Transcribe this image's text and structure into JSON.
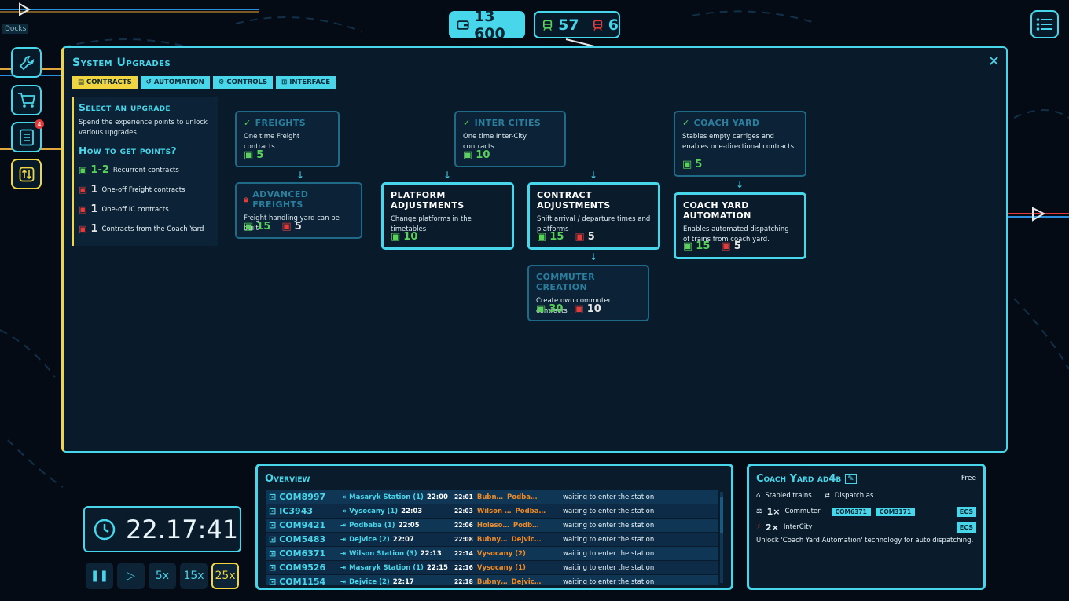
{
  "hud": {
    "money": "13 600",
    "green_points": "57",
    "red_points": "6"
  },
  "map": {
    "label": "Docks"
  },
  "sidebar": {
    "notebook_badge": "4"
  },
  "panel": {
    "title": "System Upgrades",
    "tabs": [
      {
        "label": "Contracts",
        "active": true
      },
      {
        "label": "Automation",
        "active": false
      },
      {
        "label": "Controls",
        "active": false
      },
      {
        "label": "Interface",
        "active": false
      }
    ],
    "info": {
      "heading": "Select an upgrade",
      "text": "Spend the experience points to unlock various upgrades.",
      "how_heading": "How to get points?",
      "rows": [
        {
          "num": "1-2",
          "text": "Recurrent contracts"
        },
        {
          "num": "1",
          "text": "One-off Freight contracts"
        },
        {
          "num": "1",
          "text": "One-off IC contracts"
        },
        {
          "num": "1",
          "text": "Contracts from the Coach Yard"
        }
      ]
    },
    "cards": {
      "freights": {
        "title": "Freights",
        "desc": "One time Freight contracts",
        "green": "5"
      },
      "adv_freights": {
        "title": "Advanced Freights",
        "desc": "Freight handling yard can be built",
        "green": "15",
        "red": "5"
      },
      "intercities": {
        "title": "Inter Cities",
        "desc": "One time Inter-City contracts",
        "green": "10"
      },
      "platform_adj": {
        "title": "Platform Adjustments",
        "desc": "Change platforms in the timetables",
        "green": "10"
      },
      "contract_adj": {
        "title": "Contract Adjustments",
        "desc": "Shift arrival / departure times and platforms",
        "green": "15",
        "red": "5"
      },
      "commuter": {
        "title": "Commuter Creation",
        "desc": "Create own commuter contracts",
        "green": "30",
        "red": "10"
      },
      "coach_yard": {
        "title": "Coach Yard",
        "desc": "Stables empty carriges and enables one-directional contracts.",
        "green": "5"
      },
      "coach_auto": {
        "title": "Coach Yard Automation",
        "desc": "Enables automated dispatching of trains from coach yard.",
        "green": "15",
        "red": "5"
      }
    }
  },
  "clock": {
    "time": "22.17:41",
    "speeds": [
      "5x",
      "15x",
      "25x"
    ]
  },
  "overview": {
    "title": "Overview",
    "rows": [
      {
        "id": "COM8997",
        "from": "Masaryk Station (1)",
        "from_time": "22:00",
        "to_time": "22:01",
        "to_a": "Bubn…",
        "to_b": "Podba…",
        "status": "waiting to enter the station"
      },
      {
        "id": "IC3943",
        "from": "Vysocany (1)",
        "from_time": "22:03",
        "to_time": "22:03",
        "to_a": "Wilson …",
        "to_b": "Podba…",
        "status": "waiting to enter the station"
      },
      {
        "id": "COM9421",
        "from": "Podbaba (1)",
        "from_time": "22:05",
        "to_time": "22:06",
        "to_a": "Holeso…",
        "to_b": "Podb…",
        "status": "waiting to enter the station"
      },
      {
        "id": "COM5483",
        "from": "Dejvice (2)",
        "from_time": "22:07",
        "to_time": "22:08",
        "to_a": "Bubny…",
        "to_b": "Dejvic…",
        "status": "waiting to enter the station"
      },
      {
        "id": "COM6371",
        "from": "Wilson Station (3)",
        "from_time": "22:13",
        "to_time": "22:14",
        "to_a": "Vysocany (2)",
        "to_b": "",
        "status": "waiting to enter the station"
      },
      {
        "id": "COM9526",
        "from": "Masaryk Station (1)",
        "from_time": "22:15",
        "to_time": "22:16",
        "to_a": "Vysocany (1)",
        "to_b": "",
        "status": "waiting to enter the station"
      },
      {
        "id": "COM1154",
        "from": "Dejvice (2)",
        "from_time": "22:17",
        "to_time": "22:18",
        "to_a": "Bubny…",
        "to_b": "Dejvic…",
        "status": "waiting to enter the station"
      }
    ]
  },
  "yard": {
    "title": "Coach Yard ad4b",
    "status": "Free",
    "stabled_label": "Stabled trains",
    "dispatch_label": "Dispatch as",
    "commuter_count": "1×",
    "commuter_label": "Commuter",
    "commuter_chips": [
      "COM6371",
      "COM3171"
    ],
    "intercity_count": "2×",
    "intercity_label": "InterCity",
    "ecs": "ECS",
    "note": "Unlock 'Coach Yard Automation' technology for auto dispatching."
  }
}
